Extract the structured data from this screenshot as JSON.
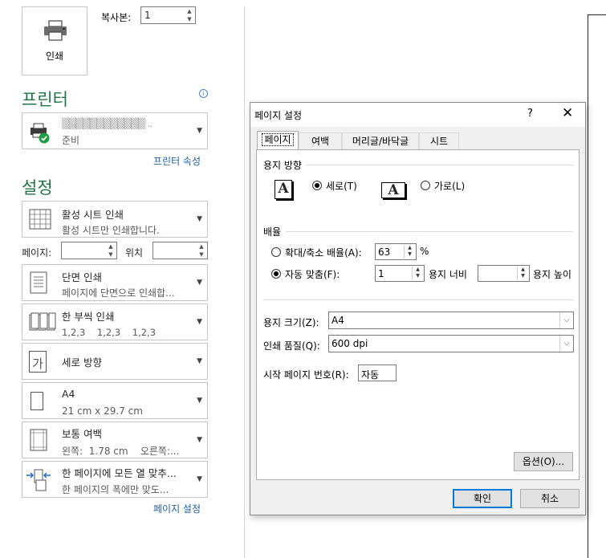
{
  "print": {
    "button_label": "인쇄",
    "copies_label": "복사본:",
    "copies_value": "1"
  },
  "printer": {
    "section_title": "프린터",
    "name": "▒▒▒▒▒▒▒▒▒▒▒▒ ..",
    "status": "준비",
    "properties_link": "프린터 속성"
  },
  "settings": {
    "section_title": "설정",
    "print_what": {
      "title": "활성 시트 인쇄",
      "subtitle": "활성 시트만 인쇄합니다."
    },
    "pages_label": "페이지:",
    "pages_value": "",
    "position_label": "위치",
    "position_value": "",
    "sides": {
      "title": "단면 인쇄",
      "subtitle": "페이지에 단면으로 인쇄합..."
    },
    "collate": {
      "title": "한 부씩 인쇄",
      "subtitle": "1,2,3    1,2,3    1,2,3"
    },
    "orientation": {
      "title": "세로 방향",
      "icon_letter": "가"
    },
    "paper": {
      "title": "A4",
      "subtitle": "21 cm x 29.7 cm"
    },
    "margins": {
      "title": "보통 여백",
      "subtitle": "왼쪽:  1.78 cm    오른쪽:..."
    },
    "scaling": {
      "title": "한 페이지에 모든 열 맞추...",
      "subtitle": "한 페이지의 폭에만 맞도..."
    },
    "page_setup_link": "페이지 설정"
  },
  "dialog": {
    "title": "페이지 설정",
    "help": "?",
    "close": "✕",
    "tabs": [
      {
        "label": "페이지",
        "active": true
      },
      {
        "label": "여백",
        "active": false
      },
      {
        "label": "머리글/바닥글",
        "active": false
      },
      {
        "label": "시트",
        "active": false
      }
    ],
    "orientation_group": "용지 방향",
    "portrait_label": "세로(T)",
    "landscape_label": "가로(L)",
    "portrait_selected": true,
    "scaling_group": "배율",
    "adjust_label": "확대/축소 배율(A):",
    "adjust_value": "63",
    "percent": "%",
    "fit_label": "자동 맞춤(F):",
    "fit_wide_value": "1",
    "fit_wide_label": "용지 너비",
    "fit_tall_value": "",
    "fit_tall_label": "용지 높이",
    "fit_selected": true,
    "paper_size_label": "용지 크기(Z):",
    "paper_size_value": "A4",
    "print_quality_label": "인쇄 품질(Q):",
    "print_quality_value": "600 dpi",
    "first_page_label": "시작 페이지 번호(R):",
    "first_page_value": "자동",
    "options_button": "옵션(O)...",
    "ok_button": "확인",
    "cancel_button": "취소",
    "default_button_color": "#0078d7"
  },
  "colors": {
    "section_title": "#217346",
    "link": "#1f5f9e"
  }
}
